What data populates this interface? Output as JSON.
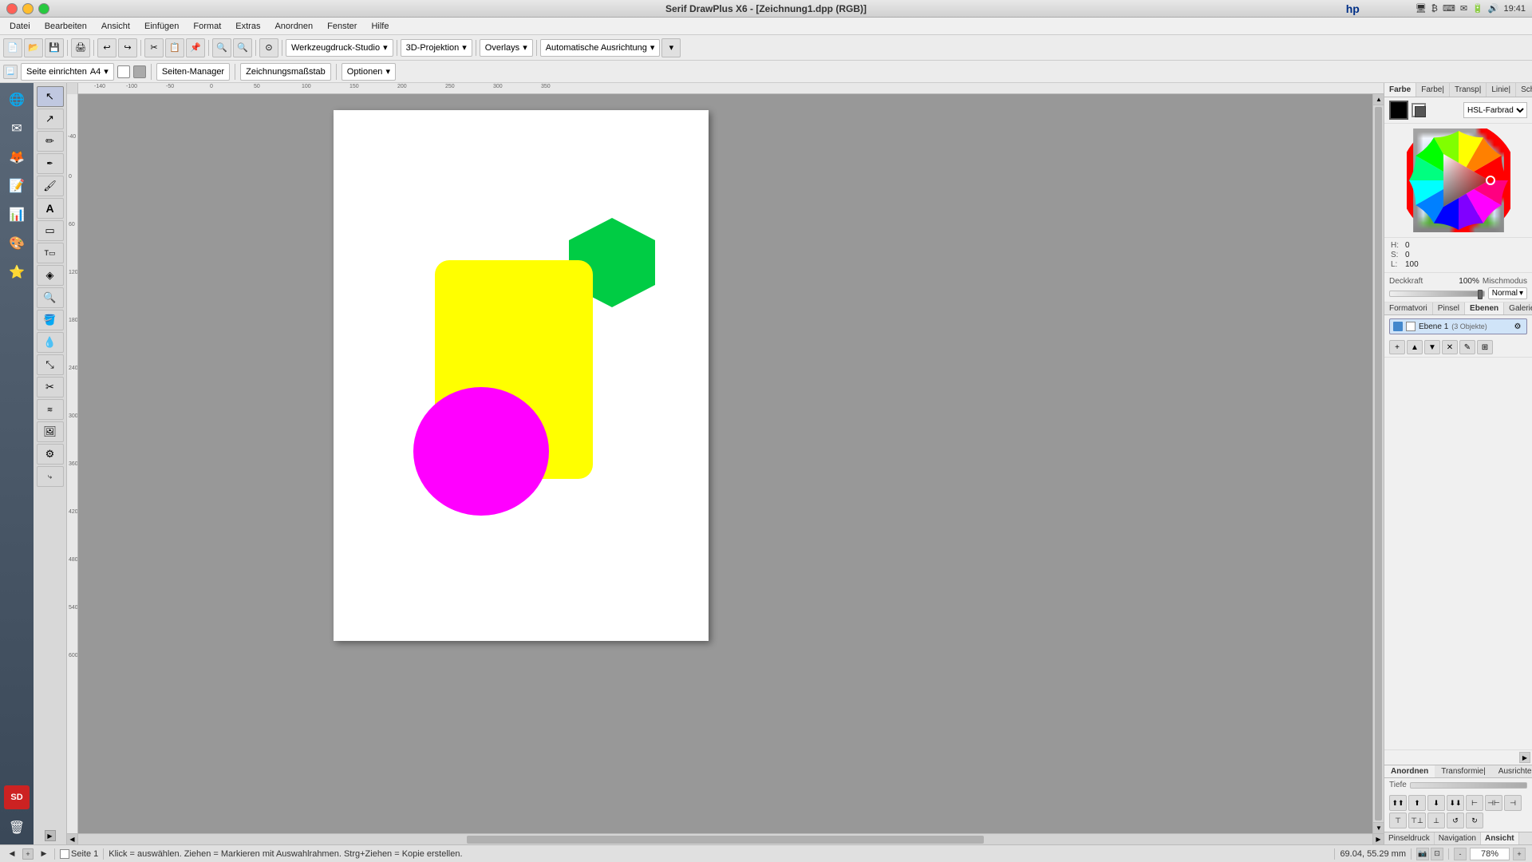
{
  "titlebar": {
    "title": "Serif DrawPlus X6 - [Zeichnung1.dpp (RGB)]",
    "time": "19:41"
  },
  "menubar": {
    "items": [
      "Datei",
      "Bearbeiten",
      "Ansicht",
      "Einfügen",
      "Format",
      "Extras",
      "Anordnen",
      "Fenster",
      "Hilfe"
    ]
  },
  "toolbar1": {
    "dropdowns": [
      "Werkzeugdruck-Studio",
      "3D-Projektion",
      "Overlays",
      "Automatische Ausrichtung"
    ]
  },
  "toolbar2": {
    "page_label": "Seite einrichten",
    "page_size": "A4",
    "seiten_manager": "Seiten-Manager",
    "zeichnungsmass": "Zeichnungsmaßstab",
    "optionen": "Optionen"
  },
  "right_panel": {
    "tabs": [
      "Farbe",
      "Farbe|",
      "Transp|",
      "Linie|",
      "Schal"
    ],
    "color_model": "HSL-Farbrad",
    "hue_label": "H:",
    "hue_value": "0",
    "sat_label": "S:",
    "sat_value": "0",
    "light_label": "L:",
    "light_value": "100",
    "opacity_label": "Deckkraft",
    "opacity_value": "100%",
    "blend_label": "Mischmodus",
    "blend_value": "Normal",
    "format_tabs": [
      "Formatvorlage|",
      "Pinsel",
      "Ebenen",
      "Galerie"
    ],
    "layer_name": "Ebene 1",
    "layer_objects": "(3 Objekte)",
    "bottom_tabs": [
      "Anordnen",
      "Transformie|",
      "Ausrichten"
    ],
    "depth_label": "Tiefe",
    "nav_tabs": [
      "Pinseldruck",
      "Navigation",
      "Ansicht"
    ]
  },
  "statusbar": {
    "page_nav_prev": "◀",
    "page_nav_next": "▶",
    "page_label": "Seite 1",
    "hint": "Klick = auswählen. Ziehen = Markieren mit Auswahlrahmen. Strg+Ziehen = Kopie erstellen.",
    "coords": "69.04, 55.29 mm",
    "zoom": "78%"
  },
  "shapes": {
    "yellow_rect": {
      "color": "#ffff00",
      "label": "yellow-rounded-rectangle"
    },
    "green_hex": {
      "color": "#00cc44",
      "label": "green-hexagon"
    },
    "magenta_ellipse": {
      "color": "#ff00ff",
      "label": "magenta-ellipse"
    }
  },
  "left_tools": [
    "cursor-arrow",
    "direct-select",
    "pencil-draw",
    "pen-tool",
    "brush-tool",
    "text-tool",
    "shape-rect",
    "shape-text",
    "node-tool",
    "zoom-tool",
    "fill-tool",
    "blur-tool",
    "transform-tool",
    "crop-tool",
    "clone-tool",
    "image-tool",
    "symbol-tool",
    "gradient-tool",
    "panel-toggle"
  ],
  "app_sidebar": [
    {
      "icon": "🌐",
      "name": "browser-icon"
    },
    {
      "icon": "✉",
      "name": "mail-icon"
    },
    {
      "icon": "🔥",
      "name": "firefox-icon"
    },
    {
      "icon": "📄",
      "name": "document-icon"
    },
    {
      "icon": "📊",
      "name": "spreadsheet-icon"
    },
    {
      "icon": "🎨",
      "name": "draw-icon"
    },
    {
      "icon": "⭐",
      "name": "star-icon"
    },
    {
      "icon": "🖥",
      "name": "desktop-icon"
    }
  ]
}
